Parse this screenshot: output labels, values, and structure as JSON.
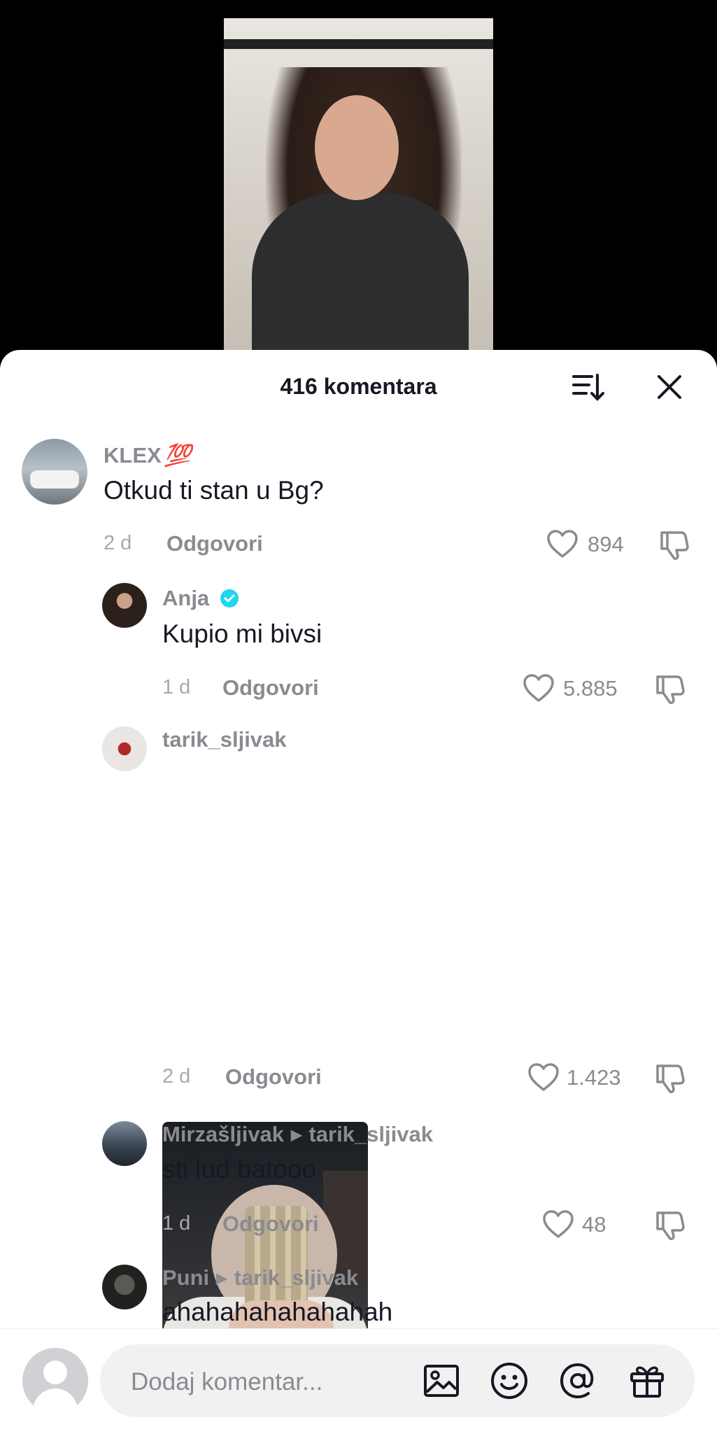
{
  "header": {
    "title": "416 komentara"
  },
  "comments": [
    {
      "username": "KLEX",
      "username_emoji": "💯",
      "text": "Otkud ti stan u Bg?",
      "date": "2 d",
      "reply": "Odgovori",
      "likes": "894"
    },
    {
      "username": "Anja",
      "text": "Kupio mi bivsi",
      "date": "1 d",
      "reply": "Odgovori",
      "likes": "5.885"
    },
    {
      "username": "tarik_sljivak",
      "date": "2 d",
      "reply": "Odgovori",
      "likes": "1.423"
    },
    {
      "username": "Mirzašljivak",
      "reply_to": "tarik_sljivak",
      "text": "sti lud batooo",
      "date": "1 d",
      "reply": "Odgovori",
      "likes": "48"
    },
    {
      "username": "Puni",
      "reply_to": "tarik_sljivak",
      "text": "ahahahahahahahah"
    }
  ],
  "input": {
    "placeholder": "Dodaj komentar..."
  },
  "colors": {
    "verified": "#20d5ec",
    "muted_text": "#8a8b91",
    "primary_text": "#161823"
  },
  "icons": [
    "sort-icon",
    "close-icon",
    "heart-icon",
    "dislike-icon",
    "verified-badge-icon",
    "image-icon",
    "emoji-icon",
    "mention-icon",
    "gift-icon"
  ]
}
